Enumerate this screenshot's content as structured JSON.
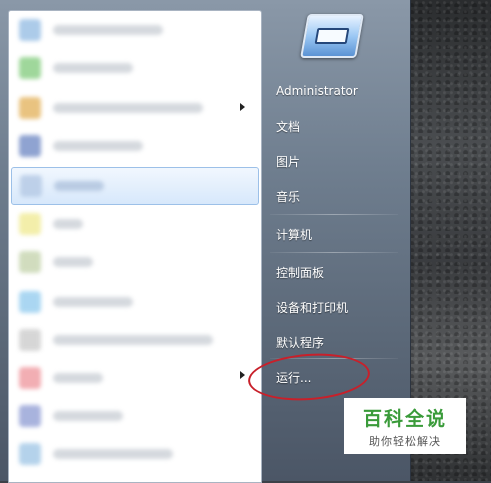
{
  "user": {
    "name": "Administrator"
  },
  "right_links": [
    {
      "label": "Administrator"
    },
    {
      "label": "文档"
    },
    {
      "label": "图片"
    },
    {
      "label": "音乐"
    },
    {
      "label": "计算机"
    },
    {
      "label": "控制面板"
    },
    {
      "label": "设备和打印机"
    },
    {
      "label": "默认程序"
    },
    {
      "label": "运行..."
    }
  ],
  "program_icons": [
    {
      "icon": "program-icon",
      "color": "#9ec2e6"
    },
    {
      "icon": "program-icon",
      "color": "#8fd18a"
    },
    {
      "icon": "program-icon",
      "color": "#e6b96a"
    },
    {
      "icon": "program-icon",
      "color": "#7c93c9"
    },
    {
      "icon": "program-icon",
      "color": "#b7cbe6"
    },
    {
      "icon": "program-icon",
      "color": "#f1ec9c"
    },
    {
      "icon": "program-icon",
      "color": "#c9d7b3"
    },
    {
      "icon": "program-icon",
      "color": "#9cd0f0"
    },
    {
      "icon": "program-icon",
      "color": "#d0d0d0"
    },
    {
      "icon": "program-icon",
      "color": "#f0a0a6"
    },
    {
      "icon": "program-icon",
      "color": "#9aa6d8"
    },
    {
      "icon": "program-icon",
      "color": "#a8cbe8"
    }
  ],
  "watermark": {
    "title": "百科全说",
    "subtitle": "助你轻松解决"
  },
  "colors": {
    "annotation": "#c8202a",
    "watermark_green": "#3a9b3a",
    "highlight": "#d7e8fb"
  }
}
